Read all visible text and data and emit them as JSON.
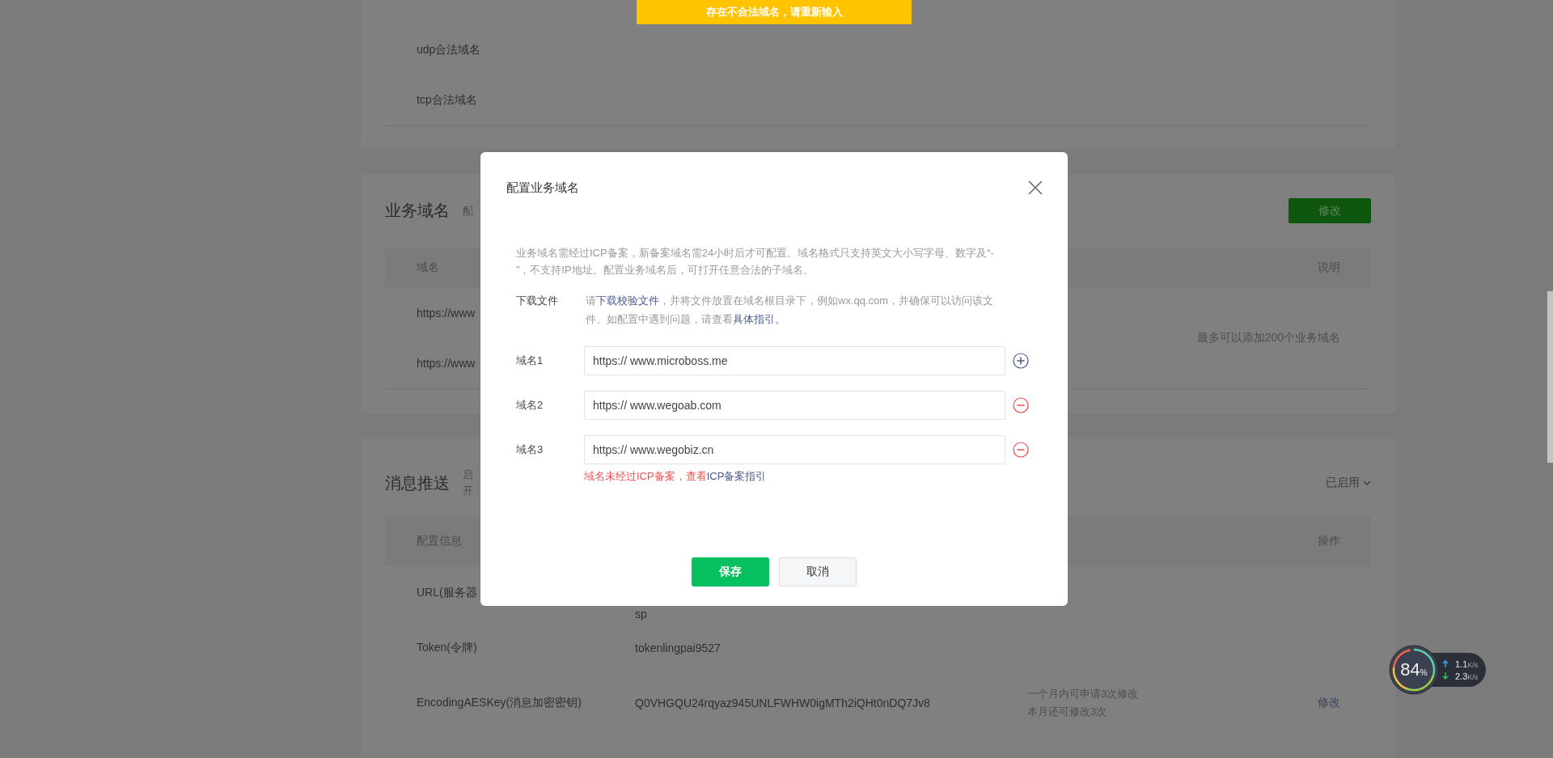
{
  "toast": "存在不合法域名，请重新输入",
  "legal_domains": {
    "rows": [
      {
        "label": "udp合法域名"
      },
      {
        "label": "tcp合法域名"
      }
    ]
  },
  "business_domains": {
    "title": "业务域名",
    "subtitle": "配",
    "edit_button": "修改",
    "columns": [
      "域名",
      "说明"
    ],
    "rows": [
      "https://www",
      "https://www"
    ],
    "note": "最多可以添加200个业务域名"
  },
  "message_push": {
    "title": "消息推送",
    "desc": [
      "启",
      "开"
    ],
    "status": "已启用",
    "columns": [
      "配置信息",
      "操作"
    ],
    "rows": [
      {
        "label": "URL(服务器",
        "value": "sp"
      },
      {
        "label": "Token(令牌)",
        "value": "tokenlingpai9527"
      },
      {
        "label": "EncodingAESKey(消息加密密钥)",
        "value": "Q0VHGQU24rqyaz945UNLFWHW0igMTh2iQHt0nDQ7Jv8",
        "note": [
          "一个月内可申请3次修改",
          "本月还可修改3次"
        ],
        "action": "修改"
      }
    ]
  },
  "dialog": {
    "title": "配置业务域名",
    "intro": "业务域名需经过ICP备案，新备案域名需24小时后才可配置。域名格式只支持英文大小写字母、数字及“- ”，不支持IP地址。配置业务域名后，可打开任意合法的子域名。",
    "download": {
      "label": "下载文件",
      "parts": [
        {
          "kind": "text",
          "text": "请"
        },
        {
          "kind": "link",
          "text": "下载校验文件"
        },
        {
          "kind": "text",
          "text": "，并将文件放置在域名根目录下，例如wx.qq.com，并确保可以访问该文件。如配置中遇到问题，请查看"
        },
        {
          "kind": "link",
          "text": "具体指引。"
        }
      ]
    },
    "domains": [
      {
        "label": "域名1",
        "value": "https:// www.microboss.me",
        "kind": "add"
      },
      {
        "label": "域名2",
        "value": "https:// www.wegoab.com",
        "kind": "remove"
      },
      {
        "label": "域名3",
        "value": "https:// www.wegobiz.cn",
        "kind": "remove",
        "error": {
          "text": "域名未经过ICP备案，查看",
          "link": "ICP备案指引"
        }
      }
    ],
    "buttons": {
      "save": "保存",
      "cancel": "取消"
    }
  },
  "speed_widget": {
    "percent": "84",
    "percent_sign": "%",
    "up": "1.1",
    "up_unit": "K/s",
    "down": "2.3",
    "down_unit": "K/s"
  }
}
